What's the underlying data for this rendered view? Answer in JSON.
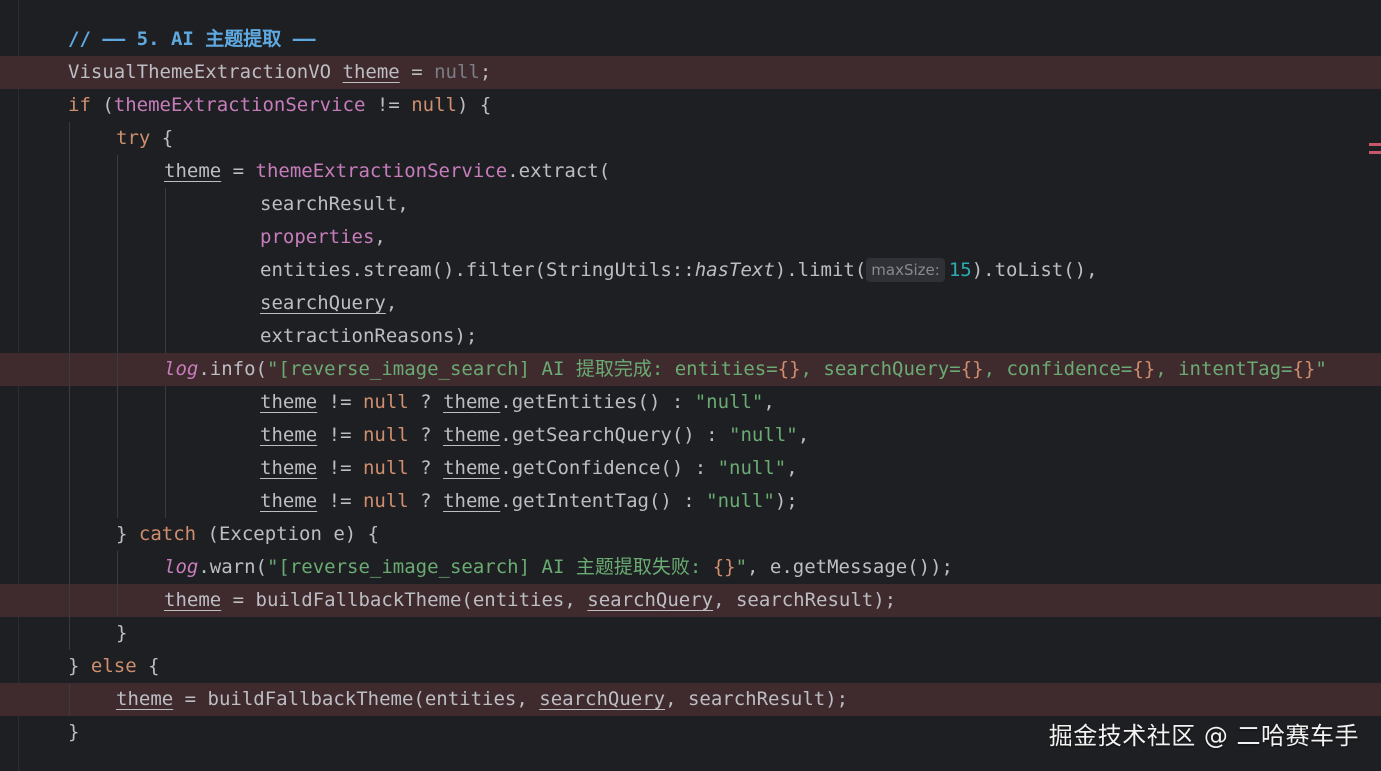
{
  "editor": {
    "comment": "// —— 5. AI 主题提取 ——",
    "lines": {
      "l2": {
        "t1": "VisualThemeExtractionVO ",
        "t2": "theme",
        "t3": " = ",
        "t4": "null",
        "t5": ";"
      },
      "l3": {
        "t1": "if",
        "t2": " (",
        "t3": "themeExtractionService",
        "t4": " != ",
        "t5": "null",
        "t6": ") {"
      },
      "l4": {
        "t1": "try",
        "t2": " {"
      },
      "l5": {
        "t1": "theme",
        "t2": " = ",
        "t3": "themeExtractionService",
        "t4": ".extract("
      },
      "l6": {
        "t1": "searchResult,"
      },
      "l7": {
        "t1": "properties",
        "t2": ","
      },
      "l8": {
        "t1": "entities.stream().filter(StringUtils::",
        "t2": "hasText",
        "t3": ").limit(",
        "hint": "maxSize:",
        "t4": "15",
        "t5": ").toList(),"
      },
      "l9": {
        "t1": "searchQuery",
        "t2": ","
      },
      "l10": {
        "t1": "extractionReasons);"
      },
      "l11": {
        "t1": "log",
        "t2": ".info(",
        "t3": "\"[reverse_image_search] AI 提取完成: entities=",
        "t4": "{}",
        "t5": ", searchQuery=",
        "t6": "{}",
        "t7": ", confidence=",
        "t8": "{}",
        "t9": ", intentTag=",
        "t10": "{}",
        "t11": "\""
      },
      "l12": {
        "t1": "theme",
        "t2": " != ",
        "t3": "null",
        "t4": " ? ",
        "t5": "theme",
        "t6": ".getEntities() : ",
        "t7": "\"null\"",
        "t8": ","
      },
      "l13": {
        "t1": "theme",
        "t2": " != ",
        "t3": "null",
        "t4": " ? ",
        "t5": "theme",
        "t6": ".getSearchQuery() : ",
        "t7": "\"null\"",
        "t8": ","
      },
      "l14": {
        "t1": "theme",
        "t2": " != ",
        "t3": "null",
        "t4": " ? ",
        "t5": "theme",
        "t6": ".getConfidence() : ",
        "t7": "\"null\"",
        "t8": ","
      },
      "l15": {
        "t1": "theme",
        "t2": " != ",
        "t3": "null",
        "t4": " ? ",
        "t5": "theme",
        "t6": ".getIntentTag() : ",
        "t7": "\"null\"",
        "t8": ");"
      },
      "l16": {
        "t1": "} ",
        "t2": "catch",
        "t3": " (Exception e) {"
      },
      "l17": {
        "t1": "log",
        "t2": ".warn(",
        "t3": "\"[reverse_image_search] AI 主题提取失败: ",
        "t4": "{}",
        "t5": "\"",
        "t6": ", e.getMessage());"
      },
      "l18": {
        "t1": "theme",
        "t2": " = buildFallbackTheme(entities, ",
        "t3": "searchQuery",
        "t4": ", searchResult);"
      },
      "l19": {
        "t1": "}"
      },
      "l20": {
        "t1": "} ",
        "t2": "else",
        "t3": " {"
      },
      "l21": {
        "t1": "theme",
        "t2": " = buildFallbackTheme(entities, ",
        "t3": "searchQuery",
        "t4": ", searchResult);"
      },
      "l22": {
        "t1": "}"
      }
    }
  },
  "watermark": "掘金技术社区 @ 二哈赛车手",
  "colors": {
    "background": "#1e1f22",
    "highlight_row": "#3f2a2e",
    "keyword": "#cf8e6d",
    "field": "#c77dbb",
    "string": "#6aab73",
    "number": "#2aacb8",
    "comment": "#5fa9e0",
    "error_marker": "#c9566a"
  }
}
